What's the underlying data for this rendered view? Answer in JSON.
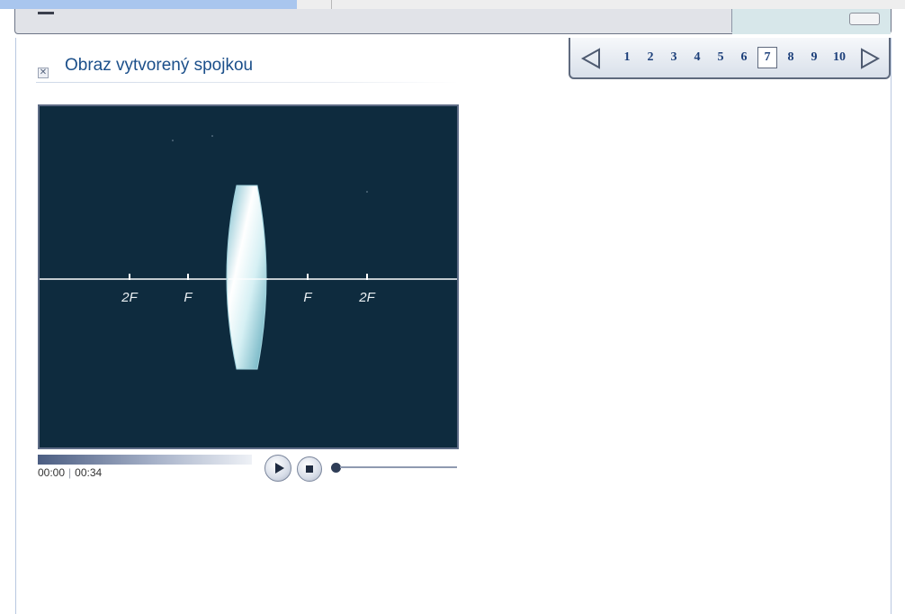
{
  "lesson": {
    "title": "Obraz vytvorený spojkou",
    "close_symbol": "✕"
  },
  "pager": {
    "prev_icon": "left-triangle-arrow",
    "next_icon": "right-triangle-arrow",
    "pages": [
      "1",
      "2",
      "3",
      "4",
      "5",
      "6",
      "7",
      "8",
      "9",
      "10"
    ],
    "current": "7"
  },
  "video": {
    "axis_labels": {
      "left_2f": "2F",
      "left_f": "F",
      "right_f": "F",
      "right_2f": "2F"
    },
    "elapsed": "00:00",
    "duration": "00:34",
    "progress": 0,
    "controls": {
      "play_icon": "play-icon",
      "stop_icon": "stop-icon"
    },
    "colors": {
      "background": "#0e2b3e",
      "axis": "#ffffff",
      "lens": "#bfe6ee"
    }
  }
}
